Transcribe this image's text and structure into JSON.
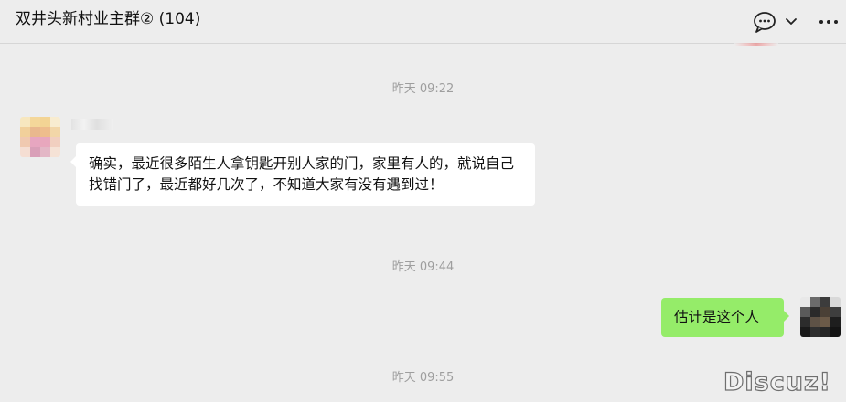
{
  "header": {
    "title": "双井头新村业主群② (104)",
    "icons": [
      "chat-bubble-icon",
      "chevron-down-icon",
      "more-icon"
    ]
  },
  "messages": [
    {
      "type": "timestamp",
      "text": "昨天 09:22"
    },
    {
      "type": "incoming",
      "text": "确实，最近很多陌生人拿钥匙开别人家的门，家里有人的，就说自己找错门了，最近都好几次了，不知道大家有没有遇到过！"
    },
    {
      "type": "timestamp",
      "text": "昨天 09:44"
    },
    {
      "type": "outgoing",
      "text": "估计是这个人"
    },
    {
      "type": "timestamp",
      "text": "昨天 09:55"
    }
  ],
  "watermark": "Discuz!",
  "colors": {
    "background": "#ededed",
    "incoming_bubble": "#ffffff",
    "outgoing_bubble": "#95ec69",
    "timestamp_text": "#9e9e9e"
  }
}
